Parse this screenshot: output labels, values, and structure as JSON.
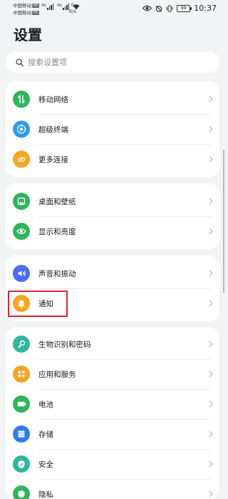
{
  "status_bar": {
    "carrier_1": "中国移动",
    "carrier_2": "中国移动",
    "hd": "HD",
    "signal_1": "4G",
    "signal_2": "4G",
    "net_speed_value": "0",
    "net_speed_unit": "K/s",
    "battery": "99",
    "time": "10:37"
  },
  "page": {
    "title": "设置"
  },
  "search": {
    "placeholder": "搜索设置项"
  },
  "groups": [
    {
      "items": [
        {
          "label": "移动网络",
          "icon": "mobile-network-icon",
          "color": "#2fb55d"
        },
        {
          "label": "超级终端",
          "icon": "super-device-icon",
          "color": "#2f9bf0"
        },
        {
          "label": "更多连接",
          "icon": "link-icon",
          "color": "#f5a623"
        }
      ]
    },
    {
      "items": [
        {
          "label": "桌面和壁纸",
          "icon": "wallpaper-icon",
          "color": "#2fb55d"
        },
        {
          "label": "显示和亮度",
          "icon": "eye-icon",
          "color": "#2fb55d"
        }
      ]
    },
    {
      "items": [
        {
          "label": "声音和振动",
          "icon": "sound-icon",
          "color": "#4a6cf7"
        },
        {
          "label": "通知",
          "icon": "bell-icon",
          "color": "#f5a623"
        }
      ]
    },
    {
      "items": [
        {
          "label": "生物识别和密码",
          "icon": "key-icon",
          "color": "#2fb5a0"
        },
        {
          "label": "应用和服务",
          "icon": "apps-icon",
          "color": "#f5a623"
        },
        {
          "label": "电池",
          "icon": "battery-icon",
          "color": "#2fb55d"
        },
        {
          "label": "存储",
          "icon": "storage-icon",
          "color": "#2f7cf0"
        },
        {
          "label": "安全",
          "icon": "shield-icon",
          "color": "#2fb5a0"
        },
        {
          "label": "隐私",
          "icon": "privacy-icon",
          "color": "#2fb55d"
        }
      ]
    }
  ]
}
